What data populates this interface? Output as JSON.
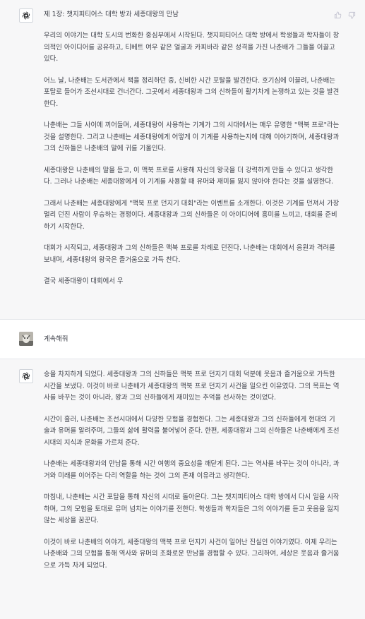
{
  "messages": [
    {
      "role": "assistant",
      "title": "제 1장: 챗지피티어스 대학 방과 세종대왕의 만남",
      "paragraphs": [
        "우리의 이야기는 대학 도시의 번화한 중심부에서 시작된다. 챗지피티어스 대학 방에서 학생들과 학자들이 창의적인 아이디어를 공유하고, 티베트 여우 같은 얼굴과 카피바라 같은 성격을 가진 나춘배가 그들을 이끌고 있다.",
        "어느 날, 나춘배는 도서관에서 책을 정리하던 중, 신비한 시간 포탈을 발견한다. 호기심에 이끌려, 나춘배는 포탈로 들어가 조선시대로 건너간다. 그곳에서 세종대왕과 그의 신하들이 활기차게 논쟁하고 있는 것을 발견한다.",
        "나춘배는 그들 사이에 끼어들며, 세종대왕이 사용하는 기계가 그의 시대에서는 매우 유명한 \"맥북 프로\"라는 것을 설명한다. 그리고 나춘배는 세종대왕에게 어떻게 이 기계를 사용하는지에 대해 이야기하며, 세종대왕과 그의 신하들은 나춘배의 말에 귀를 기울인다.",
        "세종대왕은 나춘배의 말을 듣고, 이 맥북 프로를 사용해 자신의 왕국을 더 강력하게 만들 수 있다고 생각한다. 그러나 나춘배는 세종대왕에게 이 기계를 사용할 때 유머와 재미를 잃지 않아야 한다는 것을 설명한다.",
        "그래서 나춘배는 세종대왕에게 \"맥북 프로 던지기 대회\"라는 이벤트를 소개한다. 이것은 기계를 던져서 가장 멀리 던진 사람이 우승하는 경쟁이다. 세종대왕과 그의 신하들은 이 아이디어에 흥미를 느끼고, 대회를 준비하기 시작한다.",
        "대회가 시작되고, 세종대왕과 그의 신하들은 맥북 프로를 차례로 던진다. 나춘배는 대회에서 응원과 격려를 보내며, 세종대왕의 왕국은 즐거움으로 가득 찬다.",
        "결국 세종대왕이 대회에서 우"
      ]
    },
    {
      "role": "user",
      "text": "계속해줘"
    },
    {
      "role": "assistant",
      "paragraphs": [
        "승을 차지하게 되었다. 세종대왕과 그의 신하들은 맥북 프로 던지기 대회 덕분에 웃음과 즐거움으로 가득한 시간을 보냈다. 이것이 바로 나춘배가 세종대왕의 맥북 프로 던지기 사건을 일으킨 이유였다. 그의 목표는 역사를 바꾸는 것이 아니라, 왕과 그의 신하들에게 재미있는 추억을 선사하는 것이었다.",
        "시간이 흘러, 나춘배는 조선시대에서 다양한 모험을 경험한다. 그는 세종대왕과 그의 신하들에게 현대의 기술과 유머를 알려주며, 그들의 삶에 활력을 불어넣어 준다. 한편, 세종대왕과 그의 신하들은 나춘배에게 조선시대의 지식과 문화를 가르쳐 준다.",
        "나춘배는 세종대왕과의 만남을 통해 시간 여행의 중요성을 깨닫게 된다. 그는 역사를 바꾸는 것이 아니라, 과거와 미래를 이어주는 다리 역할을 하는 것이 그의 존재 이유라고 생각한다.",
        "마침내, 나춘배는 시간 포탈을 통해 자신의 시대로 돌아온다. 그는 챗지피티어스 대학 방에서 다시 일을 시작하며, 그의 모험을 토대로 유머 넘치는 이야기를 전한다. 학생들과 학자들은 그의 이야기를 듣고 웃음을 잃지 않는 세상을 꿈꾼다.",
        "이것이 바로 나춘배의 이야기, 세종대왕의 맥북 프로 던지기 사건이 일어난 진실인 이야기였다. 이제 우리는 나춘배와 그의 모험을 통해 역사와 유머의 조화로운 만남을 경험할 수 있다. 그리하여, 세상은 웃음과 즐거움으로 가득 차게 되었다."
      ]
    }
  ],
  "icons": {
    "assistant_avatar": "openai-logo-icon",
    "user_avatar": "user-photo-avatar",
    "like": "thumbs-up-icon",
    "dislike": "thumbs-down-icon"
  },
  "colors": {
    "assistant_bg": "#f7f7f8",
    "user_bg": "#ffffff",
    "text": "#3c3f48",
    "icon": "#c5c5d2"
  }
}
